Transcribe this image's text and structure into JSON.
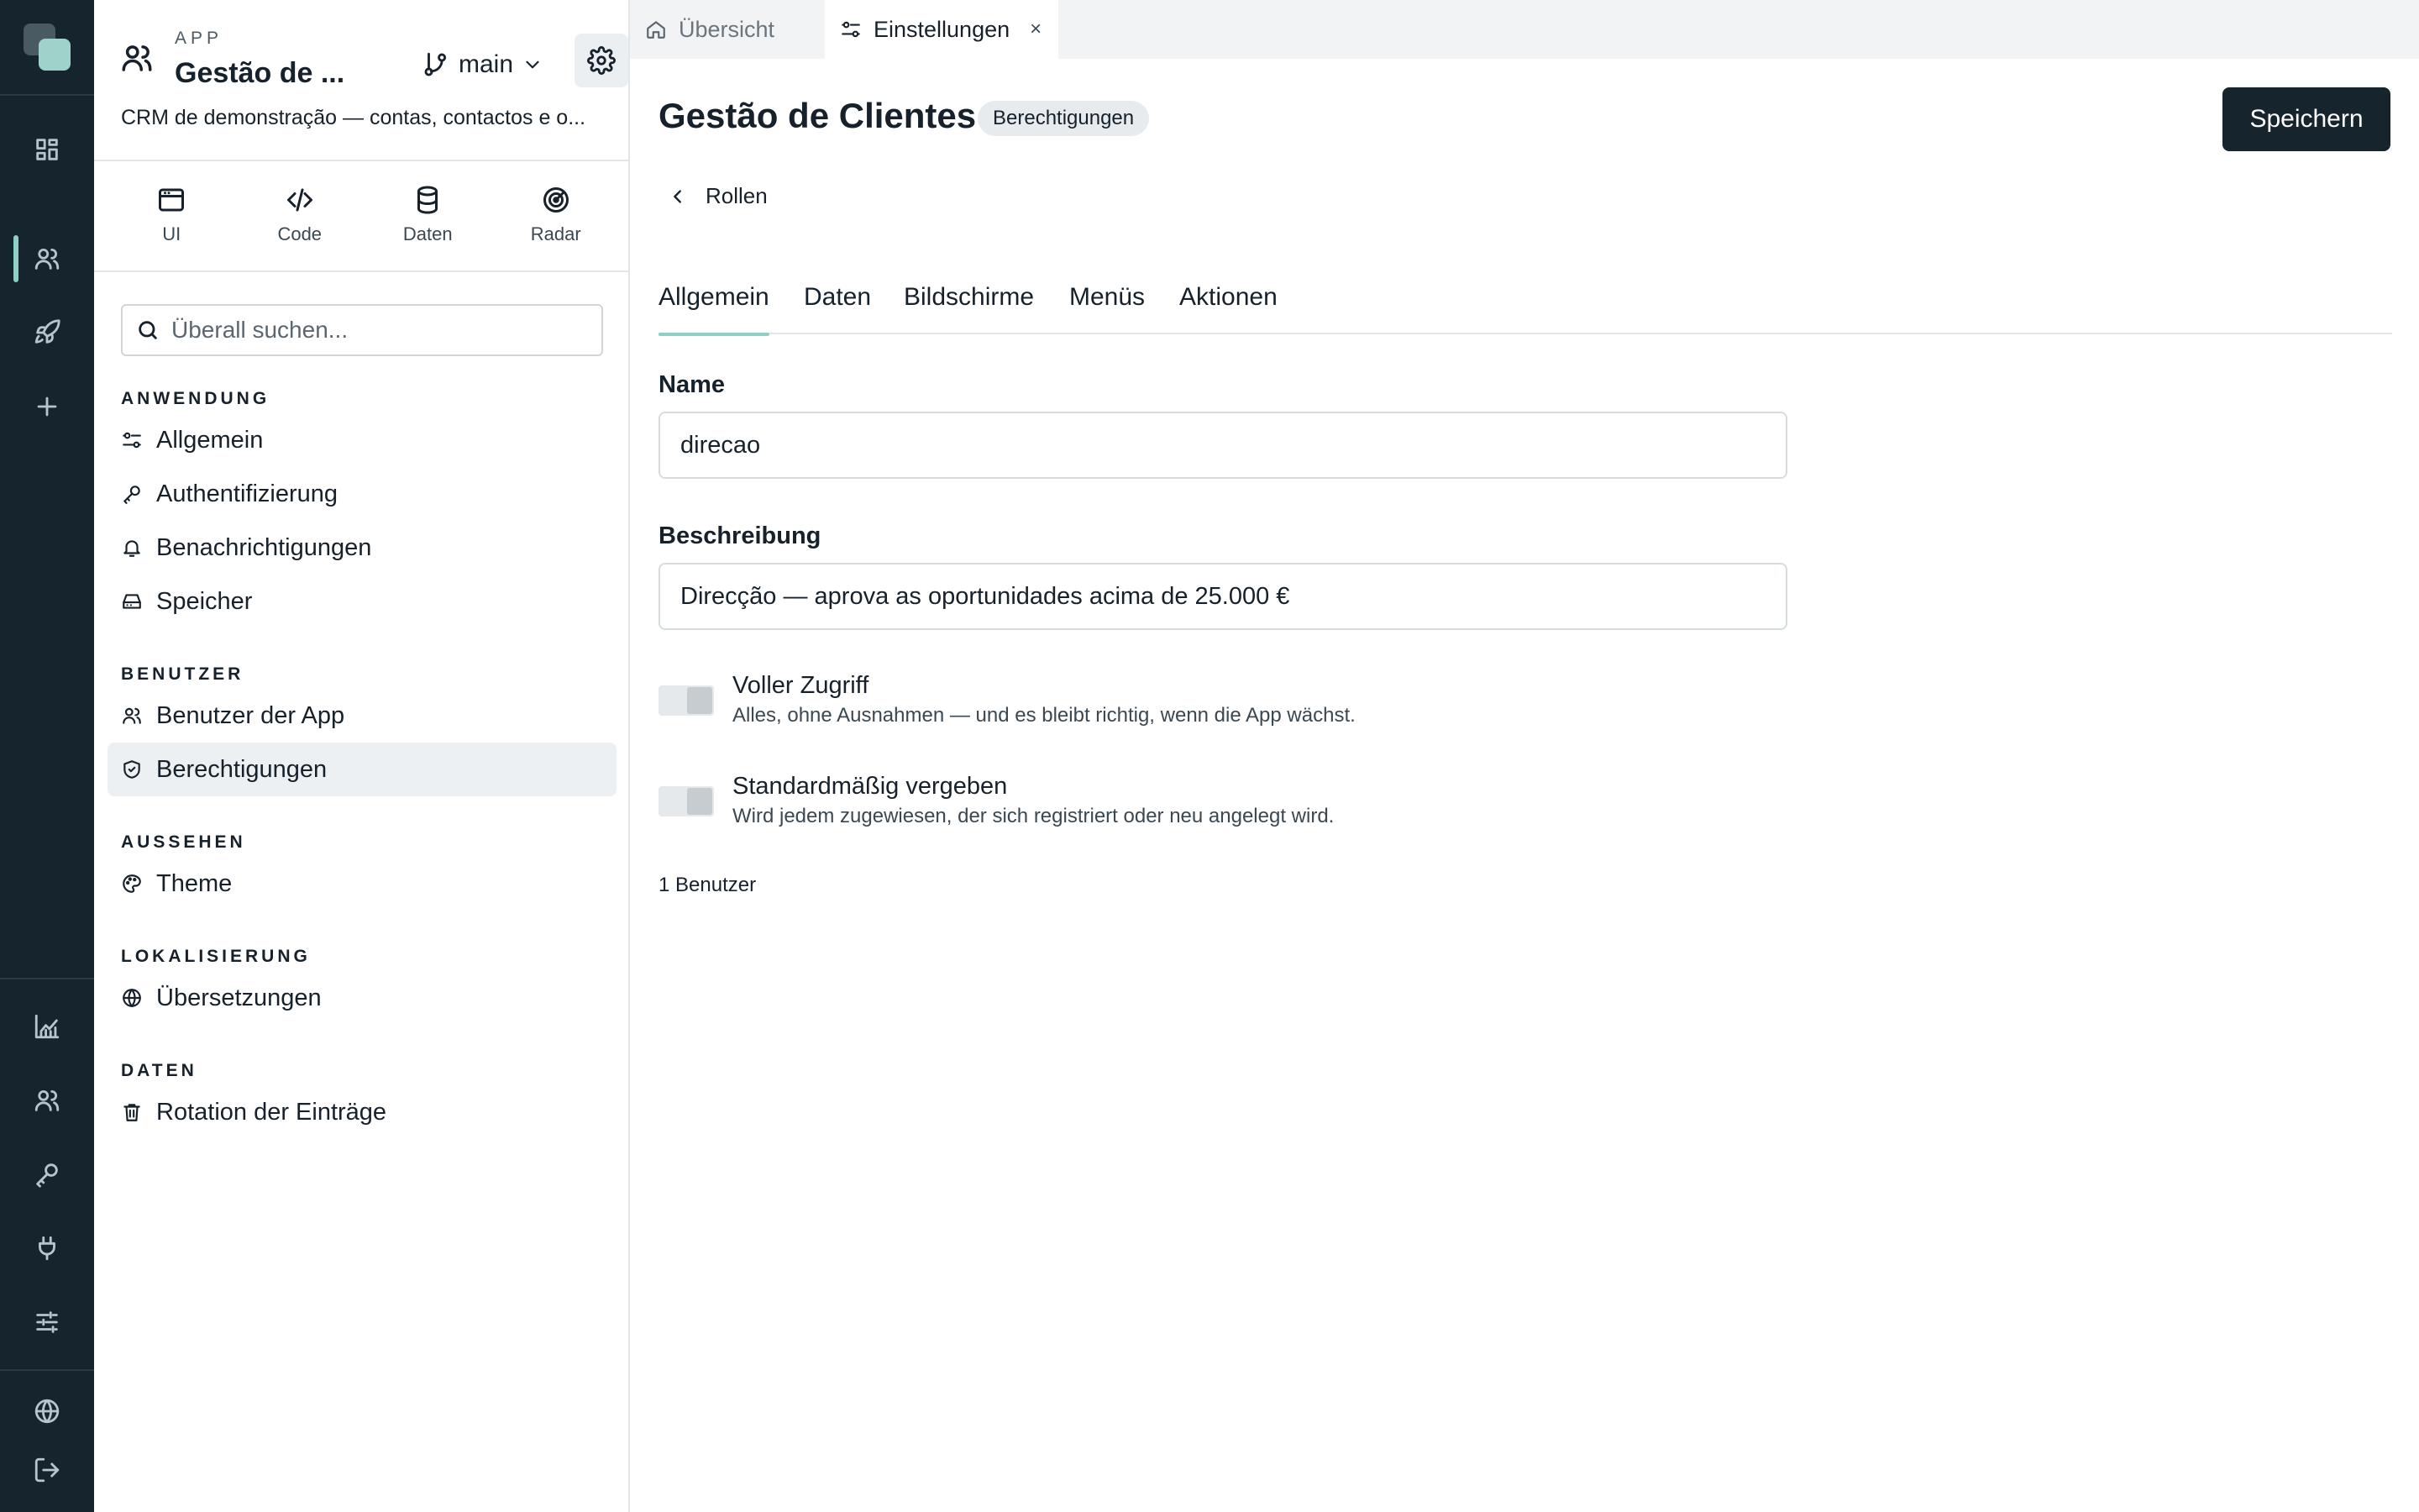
{
  "rail": {
    "icons_top": [
      "grid-icon",
      "users-icon",
      "rocket-icon",
      "plus-icon"
    ],
    "icons_bottom": [
      "chart-icon",
      "team-icon",
      "key-icon",
      "plug-icon",
      "sliders-icon",
      "globe-icon",
      "logout-icon"
    ]
  },
  "app": {
    "kicker": "APP",
    "title": "Gestão de ...",
    "branch": "main",
    "description": "CRM de demonstração — contas, contactos e o..."
  },
  "modes": [
    {
      "label": "UI",
      "icon": "window-icon"
    },
    {
      "label": "Code",
      "icon": "code-icon"
    },
    {
      "label": "Daten",
      "icon": "database-icon"
    },
    {
      "label": "Radar",
      "icon": "radar-icon"
    }
  ],
  "search": {
    "placeholder": "Überall suchen..."
  },
  "nav": {
    "sections": [
      {
        "title": "ANWENDUNG",
        "items": [
          {
            "label": "Allgemein",
            "icon": "sliders-small-icon"
          },
          {
            "label": "Authentifizierung",
            "icon": "key-icon"
          },
          {
            "label": "Benachrichtigungen",
            "icon": "bell-icon"
          },
          {
            "label": "Speicher",
            "icon": "storage-icon"
          }
        ]
      },
      {
        "title": "BENUTZER",
        "items": [
          {
            "label": "Benutzer der App",
            "icon": "users-icon"
          },
          {
            "label": "Berechtigungen",
            "icon": "shield-icon",
            "active": true
          }
        ]
      },
      {
        "title": "AUSSEHEN",
        "items": [
          {
            "label": "Theme",
            "icon": "palette-icon"
          }
        ]
      },
      {
        "title": "LOKALISIERUNG",
        "items": [
          {
            "label": "Übersetzungen",
            "icon": "globe-icon"
          }
        ]
      },
      {
        "title": "DATEN",
        "items": [
          {
            "label": "Rotation der Einträge",
            "icon": "trash-icon"
          }
        ]
      }
    ]
  },
  "tabs": [
    {
      "label": "Übersicht",
      "icon": "home-icon",
      "active": false
    },
    {
      "label": "Einstellungen",
      "icon": "sliders-small-icon",
      "active": true,
      "close": "×"
    }
  ],
  "main": {
    "title": "Gestão de Clientes",
    "badge": "Berechtigungen",
    "save_label": "Speichern",
    "back_label": "Rollen",
    "subtabs": [
      "Allgemein",
      "Daten",
      "Bildschirme",
      "Menüs",
      "Aktionen"
    ],
    "active_subtab": "Allgemein",
    "name_label": "Name",
    "name_value": "direcao",
    "description_label": "Beschreibung",
    "description_value": "Direcção — aprova as oportunidades acima de 25.000 €",
    "toggles": [
      {
        "title": "Voller Zugriff",
        "description": "Alles, ohne Ausnahmen — und es bleibt richtig, wenn die App wächst.",
        "on": false
      },
      {
        "title": "Standardmäßig vergeben",
        "description": "Wird jedem zugewiesen, der sich registriert oder neu angelegt wird.",
        "on": false
      }
    ],
    "user_count": "1 Benutzer"
  },
  "colors": {
    "rail_bg": "#15242d",
    "accent": "#8fd0c4",
    "primary_button": "#15242d"
  }
}
